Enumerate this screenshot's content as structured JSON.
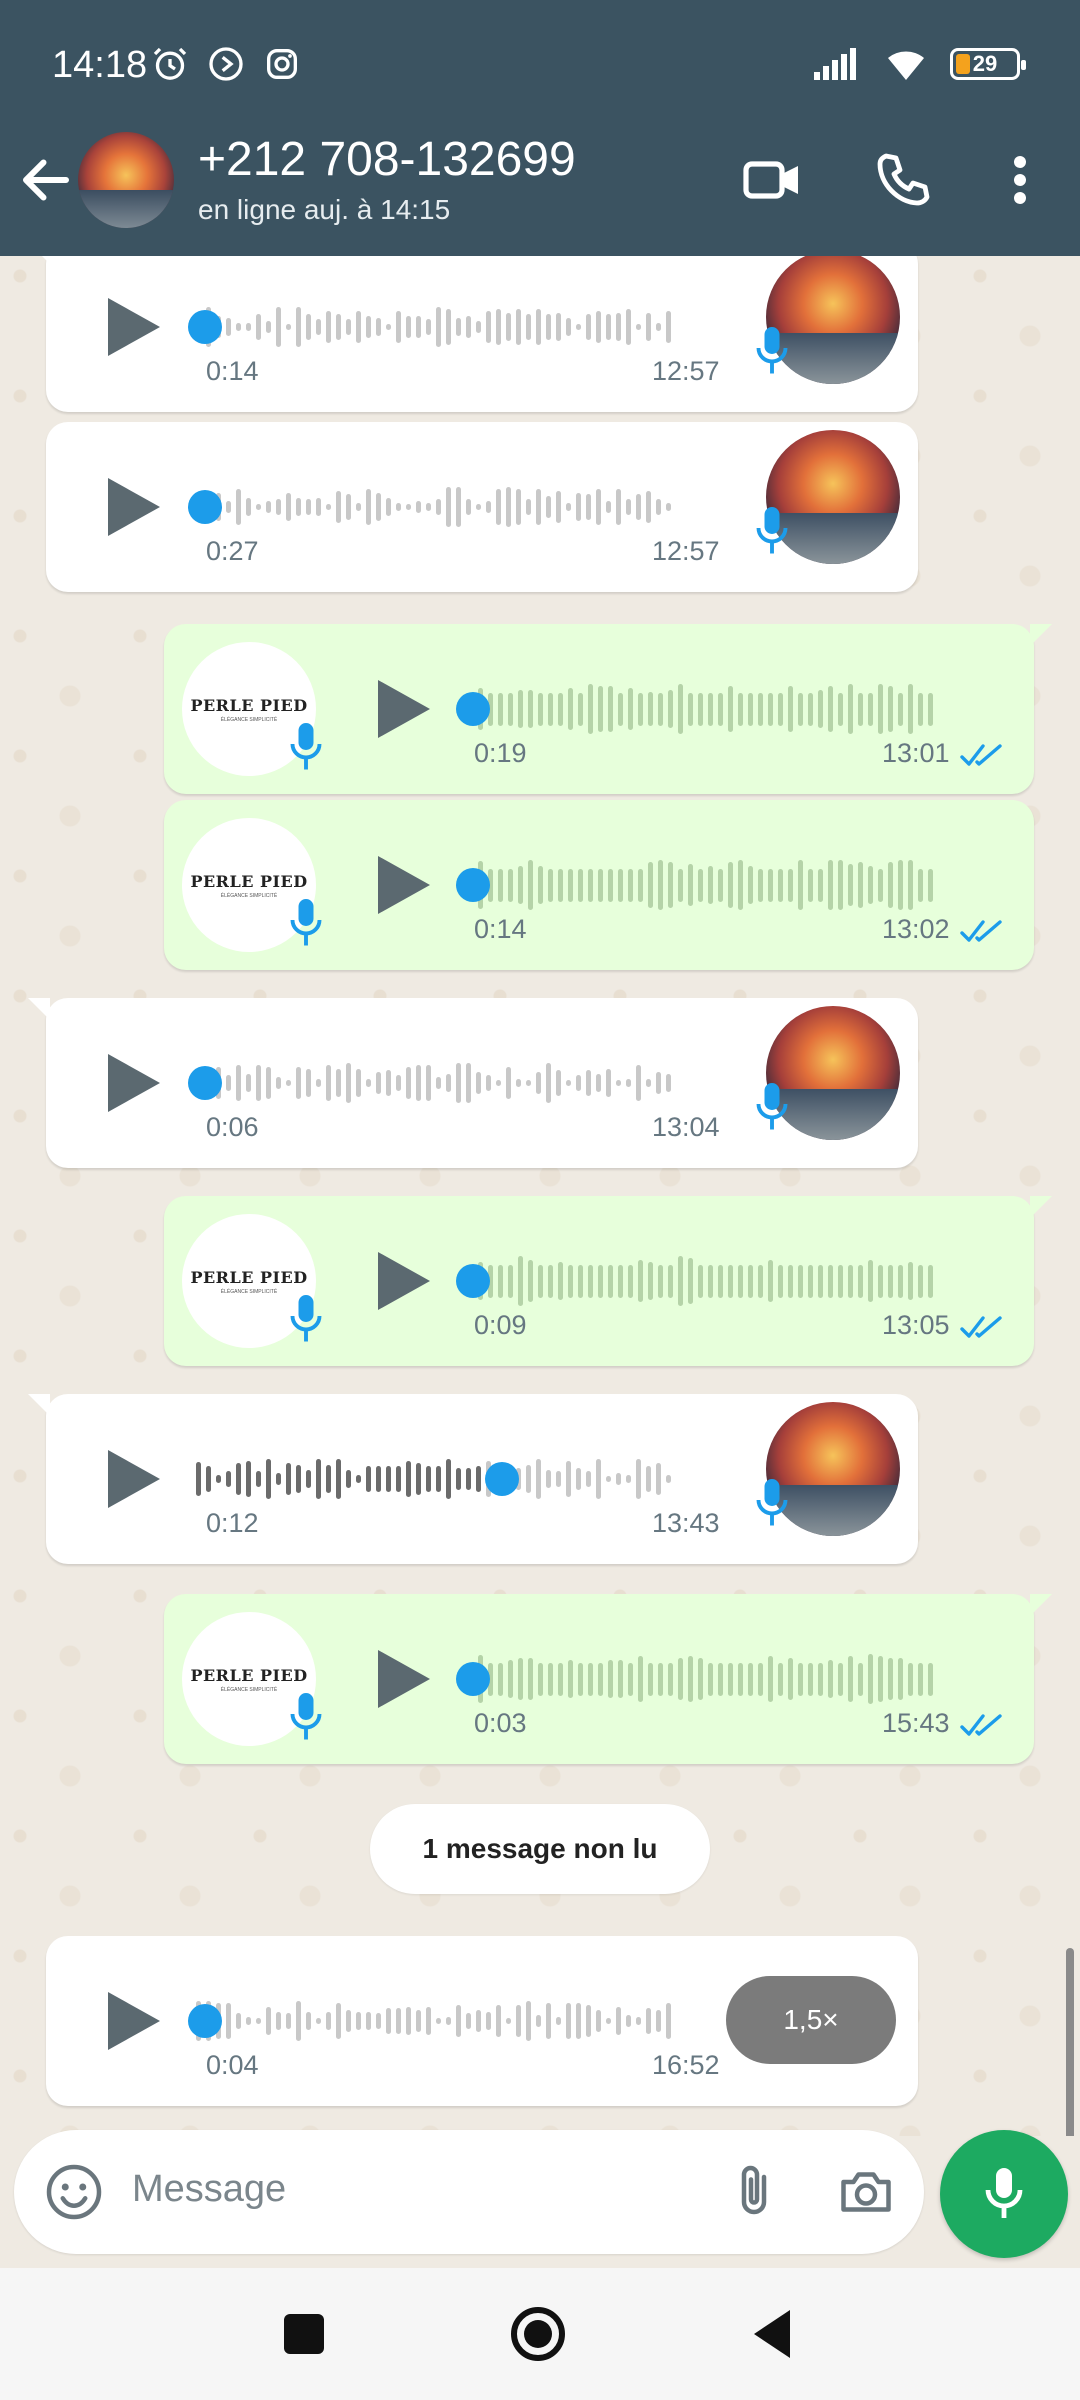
{
  "status_bar": {
    "time": "14:18",
    "battery": "29",
    "icons": [
      "alarm-icon",
      "media-icon",
      "instagram-icon",
      "signal-icon",
      "wifi-icon",
      "battery-icon"
    ]
  },
  "header": {
    "contact_name": "+212 708-132699",
    "contact_status": "en ligne auj. à 14:15",
    "icons": [
      "back-arrow-icon",
      "video-call-icon",
      "phone-icon",
      "more-vertical-icon"
    ]
  },
  "messages": [
    {
      "direction": "in",
      "duration": "0:14",
      "time": "12:57"
    },
    {
      "direction": "in",
      "duration": "0:27",
      "time": "12:57"
    },
    {
      "direction": "out",
      "duration": "0:19",
      "time": "13:01"
    },
    {
      "direction": "out",
      "duration": "0:14",
      "time": "13:02"
    },
    {
      "direction": "in",
      "duration": "0:06",
      "time": "13:04"
    },
    {
      "direction": "out",
      "duration": "0:09",
      "time": "13:05"
    },
    {
      "direction": "in",
      "duration": "0:12",
      "time": "13:43",
      "progress": 0.6
    },
    {
      "direction": "out",
      "duration": "0:03",
      "time": "15:43"
    }
  ],
  "unread_label": "1 message non lu",
  "last_message": {
    "direction": "in",
    "duration": "0:04",
    "time": "16:52",
    "speed": "1,5×"
  },
  "brand": {
    "name": "PERLE PIED",
    "tagline": "ÉLÉGANCE SIMPLICITÉ"
  },
  "input": {
    "placeholder": "Message"
  },
  "colors": {
    "header": "#3b5361",
    "accent_blue": "#1c9cea",
    "outgoing_bubble": "#e7ffdb",
    "incoming_bubble": "#ffffff",
    "mic_fab": "#1daa61"
  }
}
